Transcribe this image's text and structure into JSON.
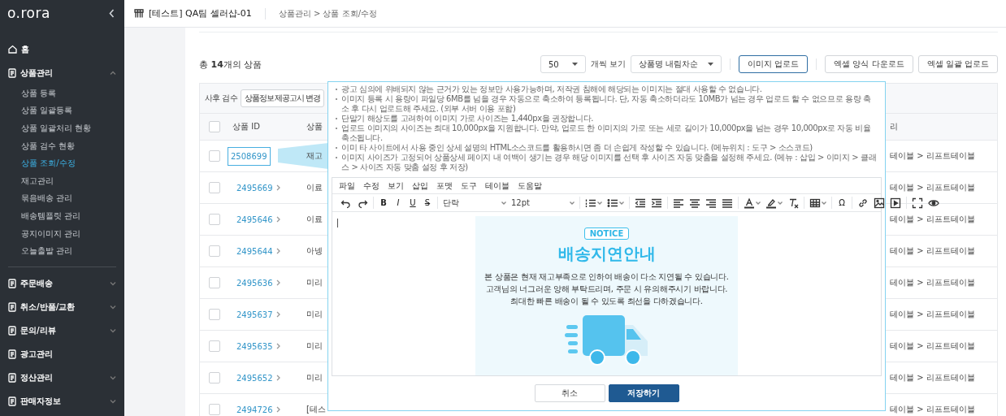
{
  "sidebar": {
    "logo": "o.rora",
    "items": [
      {
        "kind": "home",
        "label": "홈"
      },
      {
        "kind": "section",
        "label": "상품관리",
        "expanded": true,
        "children": [
          {
            "label": "상품 등록",
            "selected": false
          },
          {
            "label": "상품 일괄등록",
            "selected": false
          },
          {
            "label": "상품 일괄처리 현황",
            "selected": false
          },
          {
            "label": "상품 검수 현황",
            "selected": false
          },
          {
            "label": "상품 조회/수정",
            "selected": true
          },
          {
            "label": "재고관리",
            "selected": false
          },
          {
            "label": "묶음배송 관리",
            "selected": false
          },
          {
            "label": "배송템플릿 관리",
            "selected": false
          },
          {
            "label": "공지이미지 관리",
            "selected": false
          },
          {
            "label": "오늘출발 관리",
            "selected": false
          }
        ]
      },
      {
        "kind": "section",
        "label": "주문배송",
        "expanded": false
      },
      {
        "kind": "section",
        "label": "취소/반품/교환",
        "expanded": false
      },
      {
        "kind": "section",
        "label": "문의/리뷰",
        "expanded": false
      },
      {
        "kind": "page",
        "label": "광고관리"
      },
      {
        "kind": "section",
        "label": "정산관리",
        "expanded": false
      },
      {
        "kind": "section",
        "label": "판매자정보",
        "expanded": false
      }
    ]
  },
  "header": {
    "store": "[테스트] QA팀 셀러샵-01",
    "breadcrumb": "상품관리 > 상품 조회/수정"
  },
  "summary": "총 **14**개의 상품",
  "controls": {
    "page_size": "50",
    "page_size_suffix": "개씩 보기",
    "sort": "상품명 내림차순",
    "buttons": [
      {
        "label": "이미지 업로드",
        "kind": "primary"
      },
      {
        "label": "엑셀 양식 다운로드",
        "kind": "default"
      },
      {
        "label": "엑셀 일괄 업로드",
        "kind": "default"
      }
    ]
  },
  "table": {
    "review_label": "사후 검수",
    "review_button": "상품정보제공고시 변경",
    "header_checked": false,
    "columns": [
      "상품 ID",
      "상품",
      "리"
    ],
    "rows": [
      {
        "id": "2508699",
        "name": "재고",
        "category": "테이블 > 리프트테이블",
        "checked": false,
        "selected": true
      },
      {
        "id": "2495669",
        "name": "이료",
        "category": "테이블 > 리프트테이블",
        "checked": false,
        "selected": false
      },
      {
        "id": "2495646",
        "name": "이료",
        "category": "테이블 > 리프트테이블",
        "checked": false,
        "selected": false
      },
      {
        "id": "2495644",
        "name": "아넹",
        "category": "테이블 > 리프트테이블",
        "checked": false,
        "selected": false
      },
      {
        "id": "2495636",
        "name": "미리",
        "category": "테이블 > 리프트테이블",
        "checked": false,
        "selected": false
      },
      {
        "id": "2495637",
        "name": "미리",
        "category": "테이블 > 리프트테이블",
        "checked": false,
        "selected": false
      },
      {
        "id": "2495635",
        "name": "미리",
        "category": "테이블 > 리프트테이블",
        "checked": false,
        "selected": false
      },
      {
        "id": "2495652",
        "name": "미리",
        "category": "테이블 > 리프트테이블",
        "checked": false,
        "selected": false
      },
      {
        "id": "2494726",
        "name": "[테스",
        "category": "테이블 > 리프트테이블",
        "checked": false,
        "selected": false
      }
    ]
  },
  "editor": {
    "notes": [
      "광고 심의에 위배되지 않는 근거가 있는 정보만 사용가능하며, 저작권 침해에 해당되는 이미지는 절대 사용할 수 없습니다.",
      "이미지 등록 시 용량이 파일당 6MB를 넘을 경우 자동으로 축소하여 등록됩니다. 단, 자동 축소하더라도 10MB가 넘는 경우 업로드 할 수 없으므로 용량 축소 후 다시 업로드해 주세요. (외부 서버 이용 포함)",
      "단말기 해상도를 고려하여 이미지 가로 사이즈는 1,440px을 권장합니다.",
      "업로드 이미지의 사이즈는 최대 10,000px을 지원합니다. 만약, 업로드 한 이미지의 가로 또는 세로 길이가 10,000px을 넘는 경우 10,000px로 자동 비율 축소됩니다.",
      "이미 타 사이트에서 사용 중인 상세 설명의 HTML소스코드를 활용하시면 좀 더 손쉽게 작성할 수 있습니다. (메뉴위치 : 도구 > 소스코드)",
      "이미지 사이즈가 고정되어 상품상세 페이지 내 여백이 생기는 경우 해당 이미지를 선택 후 사이즈 자동 맞춤을 설정해 주세요. (메뉴 : 삽입 > 이미지 > 클래스 > 사이즈 자동 맞춤 설정 후 저장)"
    ],
    "menu": [
      "파일",
      "수정",
      "보기",
      "삽입",
      "포맷",
      "도구",
      "테이블",
      "도움말"
    ],
    "format_buttons": [
      "B",
      "I",
      "U",
      "S"
    ],
    "block_format": "단락",
    "font_size": "12pt",
    "special_char": "Ω",
    "notice": {
      "badge": "NOTICE",
      "title": "배송지연안내",
      "lines": [
        "본 상품은 현재 재고부족으로 인하여 배송이 다소 지연될 수 있습니다.",
        "고객님의 너그러운 양해 부탁드리며, 주문 시 유의해주시기 바랍니다.",
        "최대한 빠른 배송이 될 수 있도록 최선을 다하겠습니다."
      ]
    },
    "buttons": [
      {
        "label": "취소",
        "kind": "default"
      },
      {
        "label": "저장하기",
        "kind": "primary"
      }
    ]
  }
}
